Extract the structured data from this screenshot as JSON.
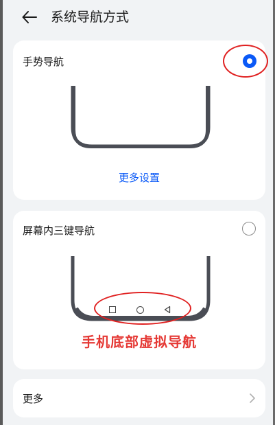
{
  "header": {
    "title": "系统导航方式",
    "back_icon": "arrow-left-icon"
  },
  "gesture_card": {
    "label": "手势导航",
    "selected": true,
    "more_settings": "更多设置"
  },
  "three_key_card": {
    "label": "屏幕内三键导航",
    "selected": false,
    "annotation": "手机底部虚拟导航",
    "nav_keys": [
      "square-icon",
      "circle-icon",
      "triangle-back-icon"
    ]
  },
  "more_row": {
    "label": "更多",
    "icon": "chevron-right-icon"
  },
  "colors": {
    "accent": "#0a59f7",
    "annotation_red": "#e53935",
    "background": "#f1f3f5",
    "card": "#ffffff"
  }
}
